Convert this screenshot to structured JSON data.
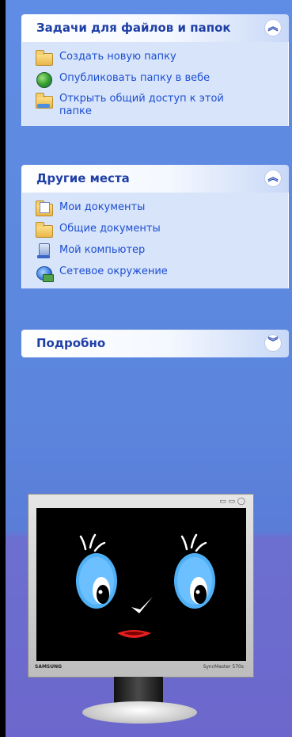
{
  "panels": [
    {
      "title": "Задачи для файлов и папок",
      "chevron": "collapse-icon",
      "items": [
        {
          "label": "Создать новую папку",
          "icon": "new-folder-icon"
        },
        {
          "label": "Опубликовать папку в вебе",
          "icon": "web-publish-icon"
        },
        {
          "label": "Открыть общий доступ к этой папке",
          "icon": "share-folder-icon"
        }
      ]
    },
    {
      "title": "Другие места",
      "chevron": "collapse-icon",
      "items": [
        {
          "label": "Мои документы",
          "icon": "my-documents-icon"
        },
        {
          "label": "Общие документы",
          "icon": "shared-documents-icon"
        },
        {
          "label": "Мой компьютер",
          "icon": "my-computer-icon"
        },
        {
          "label": "Сетевое окружение",
          "icon": "network-icon"
        }
      ]
    },
    {
      "title": "Подробно",
      "chevron": "expand-icon"
    }
  ],
  "chevrons": {
    "collapse": "︽",
    "expand": "︾"
  },
  "monitor": {
    "brand": "SAMSUNG",
    "model": "SyncMaster 570s"
  },
  "colors": {
    "pane": "#5c86de",
    "header_text": "#1f3fa6",
    "link": "#1d4ed1",
    "body": "#d7e4fa"
  }
}
